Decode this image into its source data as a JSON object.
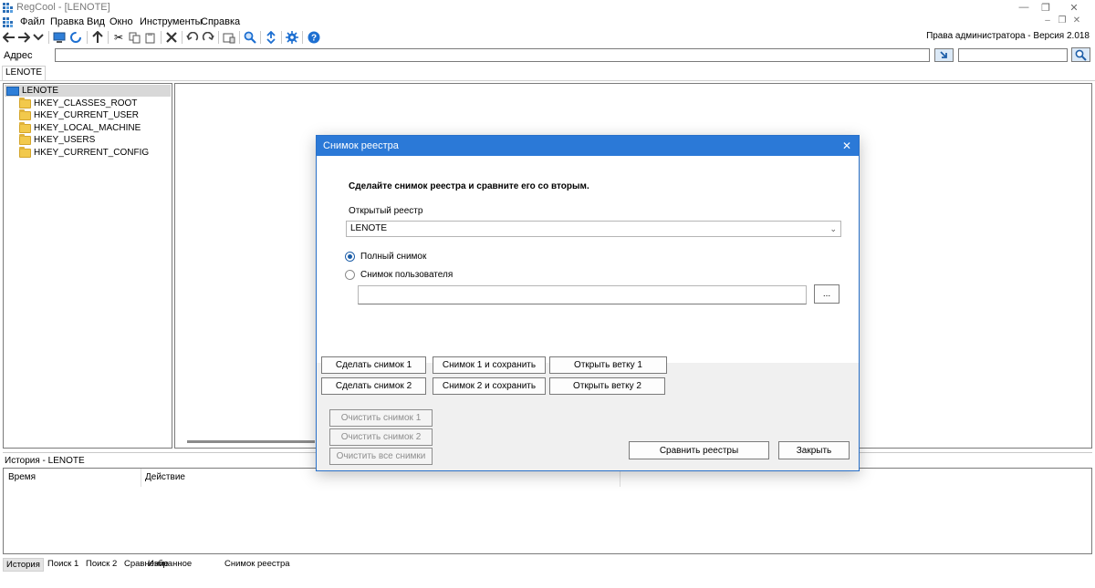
{
  "window": {
    "title": "RegCool - [LENOTE]",
    "controls": {
      "minimize": "—",
      "maximize": "❐",
      "close": "✕"
    }
  },
  "menu": {
    "items": [
      "Файл",
      "Правка",
      "Вид",
      "Окно",
      "Инструменты",
      "Справка"
    ]
  },
  "toolbar": {
    "rights_text": "Права администратора - Версия 2.018"
  },
  "address": {
    "label": "Адрес",
    "value": "",
    "search_value": ""
  },
  "tabs": {
    "active": "LENOTE"
  },
  "tree": {
    "root": "LENOTE",
    "children": [
      "HKEY_CLASSES_ROOT",
      "HKEY_CURRENT_USER",
      "HKEY_LOCAL_MACHINE",
      "HKEY_USERS",
      "HKEY_CURRENT_CONFIG"
    ]
  },
  "history": {
    "title": "История - LENOTE",
    "columns": [
      "Время",
      "Действие"
    ]
  },
  "bottom_tabs": [
    "История",
    "Поиск 1",
    "Поиск 2",
    "Сравнение",
    "Избранное",
    "Снимок реестра"
  ],
  "dialog": {
    "title": "Снимок реестра",
    "heading": "Сделайте снимок реестра и сравните его со вторым.",
    "open_registry_label": "Открытый реестр",
    "open_registry_value": "LENOTE",
    "radio_full": "Полный снимок",
    "radio_user": "Снимок пользователя",
    "browse": "...",
    "buttons": {
      "snap1": "Сделать снимок 1",
      "snap1_save": "Снимок 1 и сохранить",
      "open_branch1": "Открыть ветку 1",
      "snap2": "Сделать снимок 2",
      "snap2_save": "Снимок 2 и сохранить",
      "open_branch2": "Открыть ветку 2",
      "clear1": "Очистить снимок 1",
      "clear2": "Очистить снимок 2",
      "clear_all": "Очистить все снимки",
      "compare": "Сравнить реестры",
      "close": "Закрыть"
    }
  }
}
